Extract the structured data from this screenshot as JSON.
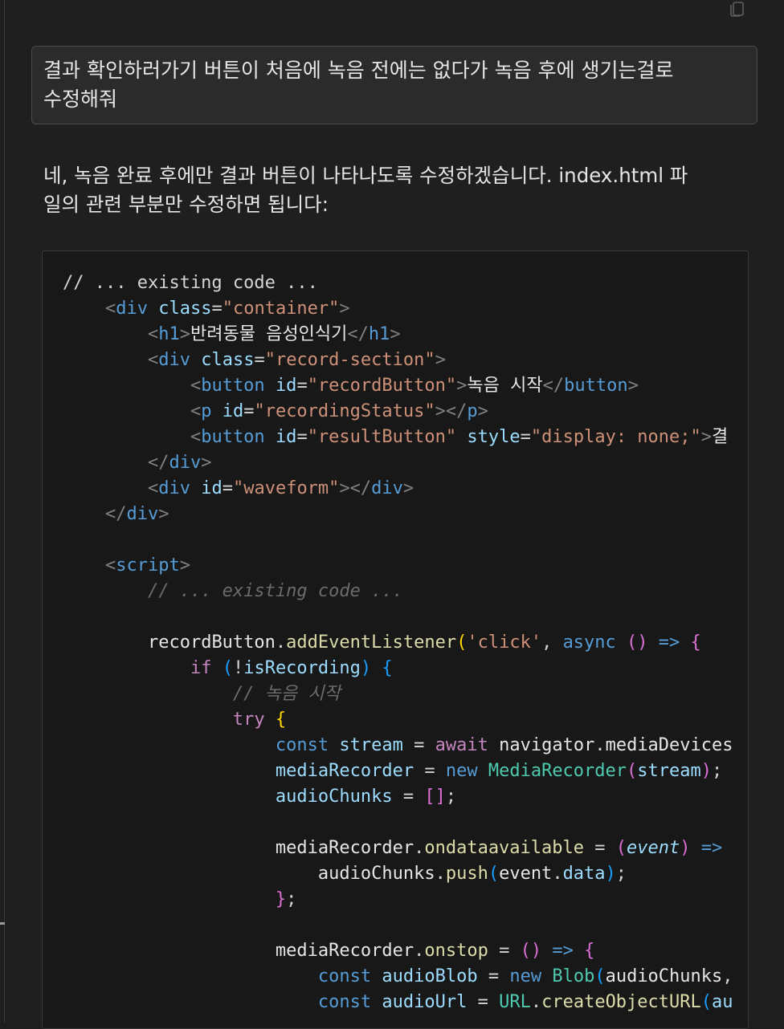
{
  "chat": {
    "user_message": "결과 확인하러가기 버튼이 처음에 녹음 전에는 없다가 녹음 후에 생기는걸로\n수정해줘",
    "assistant_message": "네, 녹음 완료 후에만 결과 버튼이 나타나도록 수정하겠습니다. index.html 파\n일의 관련 부분만 수정하면 됩니다:",
    "copy_icon": "copy-icon"
  },
  "code": {
    "language": "html",
    "lines": [
      [
        [
          "t-comment",
          "// ... existing code ..."
        ]
      ],
      [
        [
          "t-op",
          "    "
        ],
        [
          "t-punc",
          "<"
        ],
        [
          "t-tag",
          "div"
        ],
        [
          "t-op",
          " "
        ],
        [
          "t-attr",
          "class"
        ],
        [
          "t-eq",
          "="
        ],
        [
          "t-str",
          "\"container\""
        ],
        [
          "t-punc",
          ">"
        ]
      ],
      [
        [
          "t-op",
          "        "
        ],
        [
          "t-punc",
          "<"
        ],
        [
          "t-tag",
          "h1"
        ],
        [
          "t-punc",
          ">"
        ],
        [
          "t-text",
          "반려동물 음성인식기"
        ],
        [
          "t-punc",
          "</"
        ],
        [
          "t-tag",
          "h1"
        ],
        [
          "t-punc",
          ">"
        ]
      ],
      [
        [
          "t-op",
          "        "
        ],
        [
          "t-punc",
          "<"
        ],
        [
          "t-tag",
          "div"
        ],
        [
          "t-op",
          " "
        ],
        [
          "t-attr",
          "class"
        ],
        [
          "t-eq",
          "="
        ],
        [
          "t-str",
          "\"record-section\""
        ],
        [
          "t-punc",
          ">"
        ]
      ],
      [
        [
          "t-op",
          "            "
        ],
        [
          "t-punc",
          "<"
        ],
        [
          "t-tag",
          "button"
        ],
        [
          "t-op",
          " "
        ],
        [
          "t-attr",
          "id"
        ],
        [
          "t-eq",
          "="
        ],
        [
          "t-str",
          "\"recordButton\""
        ],
        [
          "t-punc",
          ">"
        ],
        [
          "t-text",
          "녹음 시작"
        ],
        [
          "t-punc",
          "</"
        ],
        [
          "t-tag",
          "button"
        ],
        [
          "t-punc",
          ">"
        ]
      ],
      [
        [
          "t-op",
          "            "
        ],
        [
          "t-punc",
          "<"
        ],
        [
          "t-tag",
          "p"
        ],
        [
          "t-op",
          " "
        ],
        [
          "t-attr",
          "id"
        ],
        [
          "t-eq",
          "="
        ],
        [
          "t-str",
          "\"recordingStatus\""
        ],
        [
          "t-punc",
          "></"
        ],
        [
          "t-tag",
          "p"
        ],
        [
          "t-punc",
          ">"
        ]
      ],
      [
        [
          "t-op",
          "            "
        ],
        [
          "t-punc",
          "<"
        ],
        [
          "t-tag",
          "button"
        ],
        [
          "t-op",
          " "
        ],
        [
          "t-attr",
          "id"
        ],
        [
          "t-eq",
          "="
        ],
        [
          "t-str",
          "\"resultButton\""
        ],
        [
          "t-op",
          " "
        ],
        [
          "t-attr",
          "style"
        ],
        [
          "t-eq",
          "="
        ],
        [
          "t-str",
          "\"display: none;\""
        ],
        [
          "t-punc",
          ">"
        ],
        [
          "t-text",
          "결"
        ]
      ],
      [
        [
          "t-op",
          "        "
        ],
        [
          "t-punc",
          "</"
        ],
        [
          "t-tag",
          "div"
        ],
        [
          "t-punc",
          ">"
        ]
      ],
      [
        [
          "t-op",
          "        "
        ],
        [
          "t-punc",
          "<"
        ],
        [
          "t-tag",
          "div"
        ],
        [
          "t-op",
          " "
        ],
        [
          "t-attr",
          "id"
        ],
        [
          "t-eq",
          "="
        ],
        [
          "t-str",
          "\"waveform\""
        ],
        [
          "t-punc",
          "></"
        ],
        [
          "t-tag",
          "div"
        ],
        [
          "t-punc",
          ">"
        ]
      ],
      [
        [
          "t-op",
          "    "
        ],
        [
          "t-punc",
          "</"
        ],
        [
          "t-tag",
          "div"
        ],
        [
          "t-punc",
          ">"
        ]
      ],
      [],
      [
        [
          "t-op",
          "    "
        ],
        [
          "t-punc",
          "<"
        ],
        [
          "t-tag",
          "script"
        ],
        [
          "t-punc",
          ">"
        ]
      ],
      [
        [
          "t-op",
          "        "
        ],
        [
          "t-comment-g",
          "// ... existing code ..."
        ]
      ],
      [],
      [
        [
          "t-op",
          "        "
        ],
        [
          "t-ident",
          "recordButton"
        ],
        [
          "t-op",
          "."
        ],
        [
          "t-fn",
          "addEventListener"
        ],
        [
          "t-brace1",
          "("
        ],
        [
          "t-str",
          "'click'"
        ],
        [
          "t-op",
          ", "
        ],
        [
          "t-kwb",
          "async"
        ],
        [
          "t-op",
          " "
        ],
        [
          "t-brace2",
          "()"
        ],
        [
          "t-op",
          " "
        ],
        [
          "t-kwb",
          "=>"
        ],
        [
          "t-op",
          " "
        ],
        [
          "t-brace2",
          "{"
        ]
      ],
      [
        [
          "t-op",
          "            "
        ],
        [
          "t-kw",
          "if"
        ],
        [
          "t-op",
          " "
        ],
        [
          "t-brace3",
          "("
        ],
        [
          "t-op",
          "!"
        ],
        [
          "t-var",
          "isRecording"
        ],
        [
          "t-brace3",
          ")"
        ],
        [
          "t-op",
          " "
        ],
        [
          "t-brace3",
          "{"
        ]
      ],
      [
        [
          "t-op",
          "                "
        ],
        [
          "t-comment-g",
          "// 녹음 시작"
        ]
      ],
      [
        [
          "t-op",
          "                "
        ],
        [
          "t-kw",
          "try"
        ],
        [
          "t-op",
          " "
        ],
        [
          "t-brace1",
          "{"
        ]
      ],
      [
        [
          "t-op",
          "                    "
        ],
        [
          "t-kwb",
          "const"
        ],
        [
          "t-op",
          " "
        ],
        [
          "t-var",
          "stream"
        ],
        [
          "t-op",
          " = "
        ],
        [
          "t-kw",
          "await"
        ],
        [
          "t-op",
          " "
        ],
        [
          "t-ident",
          "navigator"
        ],
        [
          "t-op",
          "."
        ],
        [
          "t-ident",
          "mediaDevices"
        ]
      ],
      [
        [
          "t-op",
          "                    "
        ],
        [
          "t-var",
          "mediaRecorder"
        ],
        [
          "t-op",
          " = "
        ],
        [
          "t-kwb",
          "new"
        ],
        [
          "t-op",
          " "
        ],
        [
          "t-class",
          "MediaRecorder"
        ],
        [
          "t-brace2",
          "("
        ],
        [
          "t-var",
          "stream"
        ],
        [
          "t-brace2",
          ")"
        ],
        [
          "t-op",
          ";"
        ]
      ],
      [
        [
          "t-op",
          "                    "
        ],
        [
          "t-var",
          "audioChunks"
        ],
        [
          "t-op",
          " = "
        ],
        [
          "t-brace2",
          "[]"
        ],
        [
          "t-op",
          ";"
        ]
      ],
      [],
      [
        [
          "t-op",
          "                    "
        ],
        [
          "t-ident",
          "mediaRecorder"
        ],
        [
          "t-op",
          "."
        ],
        [
          "t-fn",
          "ondataavailable"
        ],
        [
          "t-op",
          " = "
        ],
        [
          "t-brace2",
          "("
        ],
        [
          "t-param",
          "event"
        ],
        [
          "t-brace2",
          ")"
        ],
        [
          "t-op",
          " "
        ],
        [
          "t-kwb",
          "=>"
        ]
      ],
      [
        [
          "t-op",
          "                        "
        ],
        [
          "t-ident",
          "audioChunks"
        ],
        [
          "t-op",
          "."
        ],
        [
          "t-fn",
          "push"
        ],
        [
          "t-brace3",
          "("
        ],
        [
          "t-ident",
          "event"
        ],
        [
          "t-op",
          "."
        ],
        [
          "t-prop",
          "data"
        ],
        [
          "t-brace3",
          ")"
        ],
        [
          "t-op",
          ";"
        ]
      ],
      [
        [
          "t-op",
          "                    "
        ],
        [
          "t-brace2",
          "}"
        ],
        [
          "t-op",
          ";"
        ]
      ],
      [],
      [
        [
          "t-op",
          "                    "
        ],
        [
          "t-ident",
          "mediaRecorder"
        ],
        [
          "t-op",
          "."
        ],
        [
          "t-fn",
          "onstop"
        ],
        [
          "t-op",
          " = "
        ],
        [
          "t-brace2",
          "()"
        ],
        [
          "t-op",
          " "
        ],
        [
          "t-kwb",
          "=>"
        ],
        [
          "t-op",
          " "
        ],
        [
          "t-brace2",
          "{"
        ]
      ],
      [
        [
          "t-op",
          "                        "
        ],
        [
          "t-kwb",
          "const"
        ],
        [
          "t-op",
          " "
        ],
        [
          "t-var",
          "audioBlob"
        ],
        [
          "t-op",
          " = "
        ],
        [
          "t-kwb",
          "new"
        ],
        [
          "t-op",
          " "
        ],
        [
          "t-class",
          "Blob"
        ],
        [
          "t-brace3",
          "("
        ],
        [
          "t-ident",
          "audioChunks"
        ],
        [
          "t-op",
          ","
        ]
      ],
      [
        [
          "t-op",
          "                        "
        ],
        [
          "t-kwb",
          "const"
        ],
        [
          "t-op",
          " "
        ],
        [
          "t-var",
          "audioUrl"
        ],
        [
          "t-op",
          " = "
        ],
        [
          "t-class",
          "URL"
        ],
        [
          "t-op",
          "."
        ],
        [
          "t-fn",
          "createObjectURL"
        ],
        [
          "t-brace3",
          "("
        ],
        [
          "t-var",
          "au"
        ]
      ]
    ]
  }
}
